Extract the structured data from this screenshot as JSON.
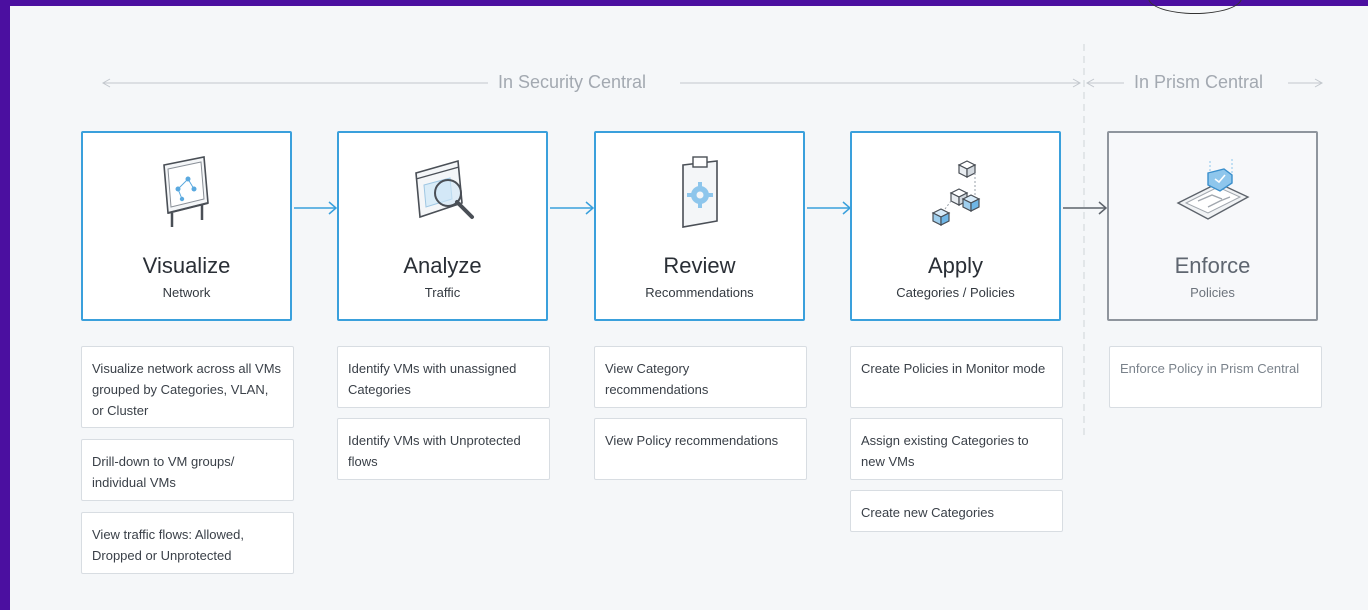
{
  "sections": {
    "left_label": "In Security Central",
    "right_label": "In Prism Central"
  },
  "stages": [
    {
      "title": "Visualize",
      "subtitle": "Network",
      "icon": "network-board-icon"
    },
    {
      "title": "Analyze",
      "subtitle": "Traffic",
      "icon": "magnifier-window-icon"
    },
    {
      "title": "Review",
      "subtitle": "Recommendations",
      "icon": "clipboard-gear-icon"
    },
    {
      "title": "Apply",
      "subtitle": "Categories / Policies",
      "icon": "stacked-cubes-icon"
    },
    {
      "title": "Enforce",
      "subtitle": "Policies",
      "icon": "shield-circuit-icon"
    }
  ],
  "details": {
    "visualize": [
      "Visualize network across all VMs grouped by Categories, VLAN, or Cluster",
      "Drill-down to VM groups/ individual VMs",
      "View traffic flows: Allowed, Dropped or Unprotected"
    ],
    "analyze": [
      "Identify VMs with unassigned Categories",
      "Identify VMs with Unprotected flows"
    ],
    "review": [
      "View Category recommendations",
      "View Policy recommendations"
    ],
    "apply": [
      "Create Policies in Monitor mode",
      "Assign existing Categories to new VMs",
      "Create new Categories"
    ],
    "enforce": [
      "Enforce Policy in Prism Central"
    ]
  },
  "colors": {
    "frame": "#4b0fa0",
    "accent_blue": "#3aa0dc",
    "gray_border": "#8f959d",
    "muted_text": "#a3a9b1"
  }
}
